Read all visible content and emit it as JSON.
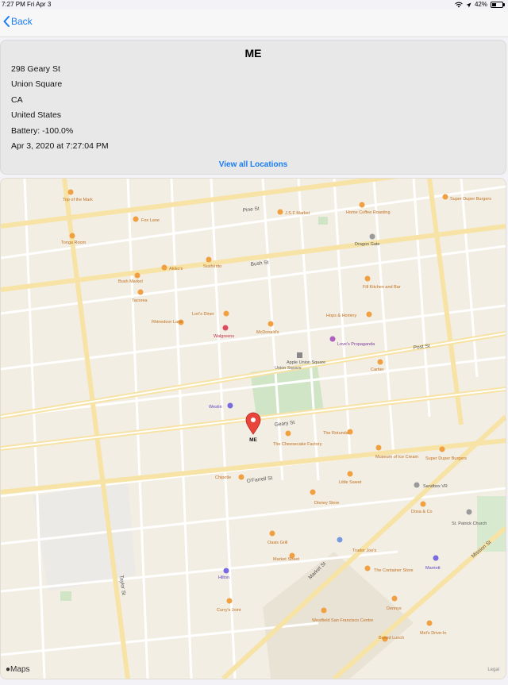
{
  "status": {
    "time": "7:27 PM",
    "date": "Fri Apr 3",
    "battery": "42%"
  },
  "nav": {
    "back_label": "Back"
  },
  "card": {
    "title": "ME",
    "lines": [
      "298 Geary St",
      "Union Square",
      "CA",
      "United States",
      "Battery: -100.0%",
      "Apr 3, 2020 at 7:27:04 PM"
    ],
    "link_label": "View all Locations"
  },
  "map": {
    "pin_label": "ME",
    "logo_label": "Maps",
    "legal_label": "Legal",
    "streets": {
      "pine": "Pine St",
      "bush": "Bush St",
      "post": "Post St",
      "geary": "Geary St",
      "ofarrell": "O'Farrell St",
      "market": "Market St",
      "mission": "Mission St",
      "taylor": "Taylor St"
    },
    "places": [
      "Top of the Mark",
      "Fox Lane",
      "J.S.F Market",
      "Home Coffee Roasting",
      "Super Duper Burgers",
      "Dragon Gate",
      "Tonga Room",
      "Akiko's",
      "Sushirrito",
      "Bush Market",
      "Tacorea",
      "Rhinedoor Lane",
      "Lori's Diner",
      "Fill Kitchen and Bar",
      "Walgreens",
      "McDonald's",
      "Hops & Hominy",
      "Love's Propaganda",
      "Union Square",
      "Apple Union Square",
      "Cartier",
      "Westin",
      "The Cheesecake Factory",
      "The Rotunda",
      "Museum of Ice Cream",
      "Super Duper Burgers",
      "Chipotle",
      "Little Sweet",
      "Disney Store",
      "Trader Joe's",
      "Marriott",
      "Oasis Grill",
      "Market Street",
      "Westfield San Francisco Centre",
      "Curry's Joint",
      "Hilton",
      "The Container Store",
      "Dennys",
      "Mel's Drive-In",
      "St. Patrick Church",
      "Dosa & Co",
      "Sandbox VR",
      "Boxed Lunch"
    ]
  }
}
